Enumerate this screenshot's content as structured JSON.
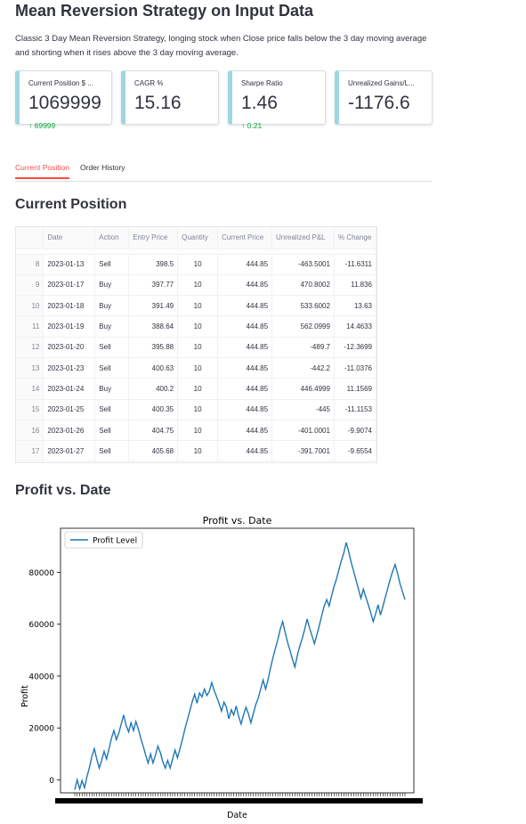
{
  "page": {
    "title": "Mean Reversion Strategy on Input Data",
    "description": "Classic 3 Day Mean Reversion Strategy, longing stock when Close price falls below the 3 day moving average and shorting when it rises above the 3 day moving average."
  },
  "metrics": [
    {
      "label": "Current Position $ ...",
      "value": "1069999",
      "delta": "69999"
    },
    {
      "label": "CAGR %",
      "value": "15.16",
      "delta": ""
    },
    {
      "label": "Sharpe Ratio",
      "value": "1.46",
      "delta": "0.21"
    },
    {
      "label": "Unrealized Gains/L...",
      "value": "-1176.6",
      "delta": ""
    }
  ],
  "tabs": [
    {
      "label": "Current Position",
      "active": true
    },
    {
      "label": "Order History",
      "active": false
    }
  ],
  "section_titles": {
    "current_position": "Current Position",
    "profit_vs_date": "Profit vs. Date"
  },
  "table": {
    "columns": [
      "",
      "Date",
      "Action",
      "Entry Price",
      "Quantity",
      "Current Price",
      "Unrealized P&L",
      "% Change"
    ],
    "rows": [
      [
        "8",
        "2023-01-13",
        "Sell",
        "398.5",
        "10",
        "444.85",
        "-463.5001",
        "-11.6311"
      ],
      [
        "9",
        "2023-01-17",
        "Buy",
        "397.77",
        "10",
        "444.85",
        "470.8002",
        "11.836"
      ],
      [
        "10",
        "2023-01-18",
        "Buy",
        "391.49",
        "10",
        "444.85",
        "533.6002",
        "13.63"
      ],
      [
        "11",
        "2023-01-19",
        "Buy",
        "388.64",
        "10",
        "444.85",
        "562.0999",
        "14.4633"
      ],
      [
        "12",
        "2023-01-20",
        "Sell",
        "395.88",
        "10",
        "444.85",
        "-489.7",
        "-12.3699"
      ],
      [
        "13",
        "2023-01-23",
        "Sell",
        "400.63",
        "10",
        "444.85",
        "-442.2",
        "-11.0376"
      ],
      [
        "14",
        "2023-01-24",
        "Buy",
        "400.2",
        "10",
        "444.85",
        "446.4999",
        "11.1569"
      ],
      [
        "15",
        "2023-01-25",
        "Sell",
        "400.35",
        "10",
        "444.85",
        "-445",
        "-11.1153"
      ],
      [
        "16",
        "2023-01-26",
        "Sell",
        "404.75",
        "10",
        "444.85",
        "-401.0001",
        "-9.9074"
      ],
      [
        "17",
        "2023-01-27",
        "Sell",
        "405.68",
        "10",
        "444.85",
        "-391.7001",
        "-9.6554"
      ]
    ]
  },
  "colors": {
    "accent_red": "#ff4b4b",
    "delta_green": "#09ab3b",
    "metric_border": "#9fd6e2",
    "line_blue": "#1f77b4"
  },
  "chart_data": {
    "type": "line",
    "title": "Profit vs. Date",
    "xlabel": "Date",
    "ylabel": "Profit",
    "ylim": [
      -5000,
      97000
    ],
    "yticks": [
      0,
      20000,
      40000,
      60000,
      80000
    ],
    "legend": "top-left",
    "grid": false,
    "series": [
      {
        "name": "Profit Level",
        "values": [
          -3800,
          0,
          -3500,
          -300,
          -3000,
          1200,
          4800,
          9000,
          12000,
          8000,
          4500,
          7500,
          11000,
          8000,
          12000,
          16000,
          19000,
          15500,
          18000,
          21500,
          25000,
          21000,
          18500,
          22000,
          19000,
          22500,
          19500,
          16000,
          13000,
          9500,
          6500,
          10000,
          6500,
          9500,
          13000,
          10500,
          7000,
          4500,
          7500,
          4500,
          8000,
          11500,
          8500,
          12000,
          15500,
          19500,
          23000,
          26500,
          30000,
          33000,
          29500,
          33500,
          32000,
          35000,
          32500,
          34000,
          37500,
          34500,
          32000,
          29500,
          26500,
          30000,
          28000,
          23500,
          27000,
          25000,
          28500,
          24500,
          21500,
          25000,
          28000,
          25500,
          22000,
          25500,
          29000,
          31500,
          35000,
          38500,
          35000,
          38500,
          43000,
          47000,
          50500,
          54000,
          58000,
          61000,
          57000,
          53000,
          50000,
          46500,
          43500,
          48000,
          51500,
          54500,
          58000,
          62000,
          58500,
          55500,
          52500,
          56000,
          59500,
          63500,
          67000,
          69500,
          67000,
          71000,
          74500,
          77500,
          81000,
          84500,
          87500,
          91500,
          88000,
          84000,
          80500,
          77000,
          73500,
          70000,
          73500,
          70500,
          67500,
          64500,
          61000,
          64000,
          67500,
          63500,
          67000,
          70500,
          74000,
          77500,
          80500,
          83000,
          79500,
          75500,
          72500,
          69500
        ]
      }
    ]
  }
}
